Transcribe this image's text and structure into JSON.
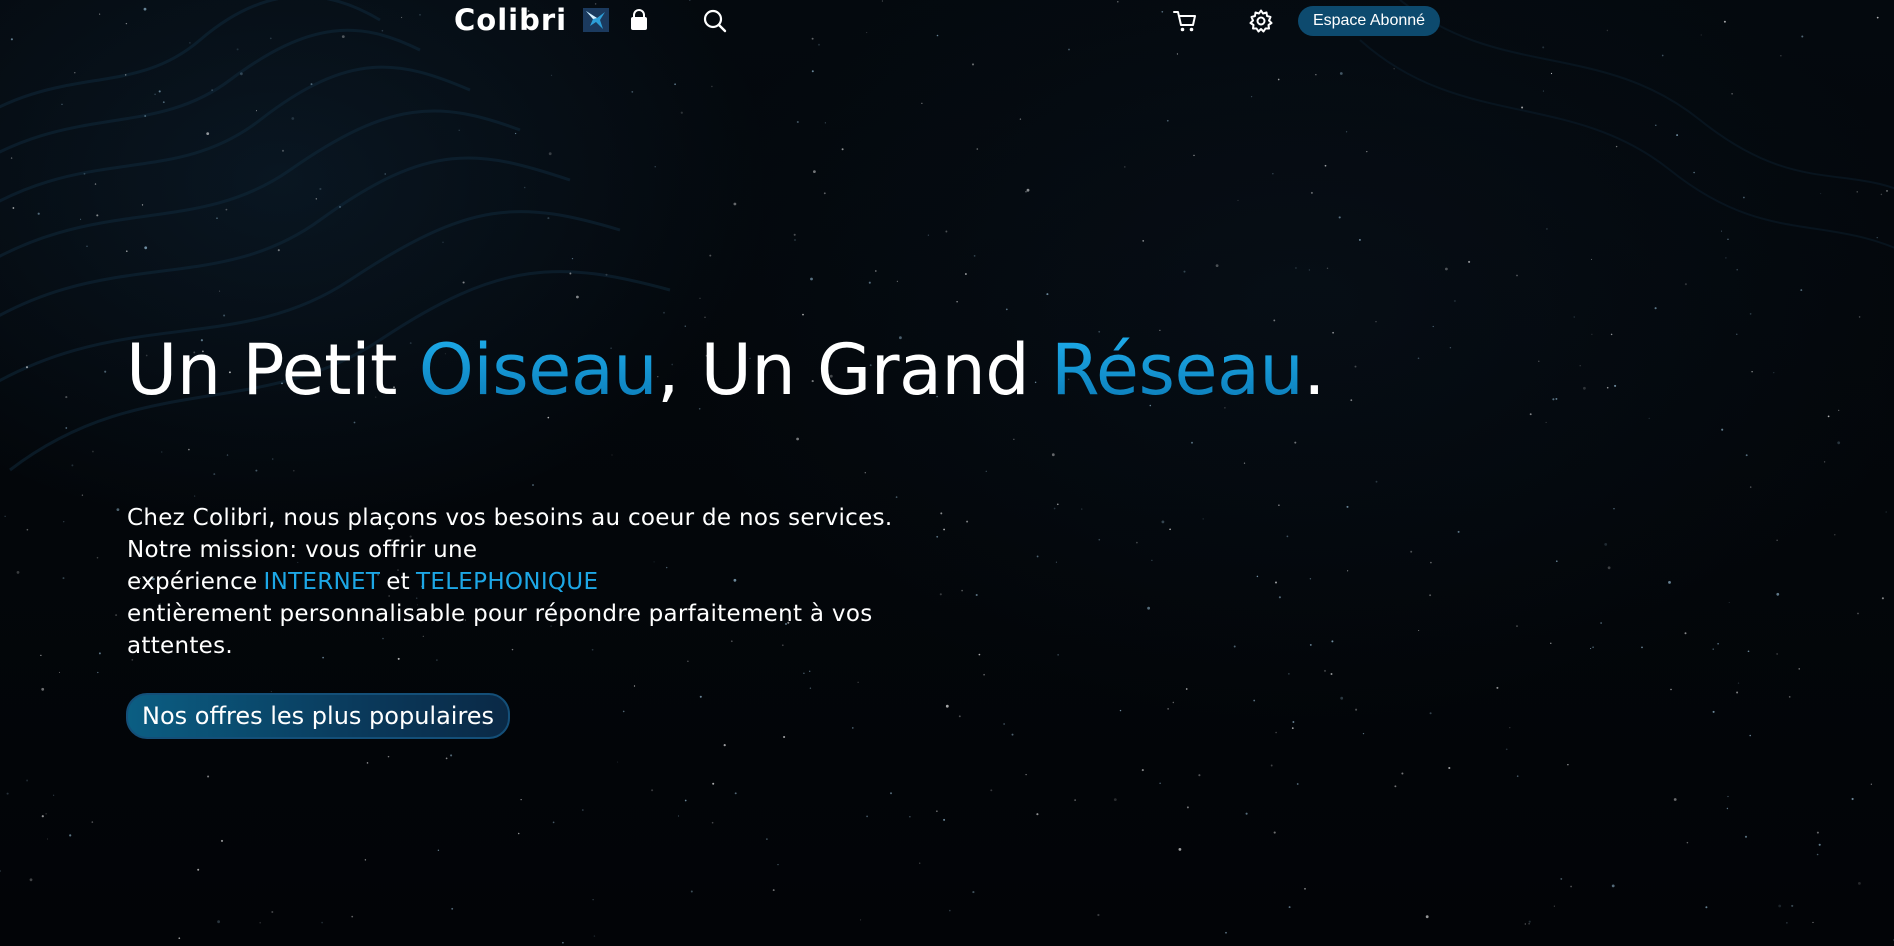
{
  "nav": {
    "brand": "Colibri",
    "icons": [
      "bag-icon",
      "search-icon",
      "cart-icon",
      "settings-icon"
    ],
    "subscriber_button": "Espace Abonné"
  },
  "hero": {
    "title_part1": "Un Petit",
    "title_accent1": "Oiseau",
    "title_part2": ", Un Grand",
    "title_accent2": "Réseau",
    "title_end": ".",
    "desc_part1": "Chez Colibri, nous plaçons vos besoins au coeur de nos services. Notre mission: vous offrir une expérience",
    "desc_highlight1": "INTERNET",
    "desc_middle": "et",
    "desc_highlight2": "TELEPHONIQUE",
    "desc_part2": "entièrement personnalisable pour répondre parfaitement à vos attentes.",
    "cta_label": "Nos offres les plus populaires"
  },
  "colors": {
    "background": "#030609",
    "accent": "#1da7e6",
    "button": "#0d4a6e",
    "text": "#ffffff"
  }
}
